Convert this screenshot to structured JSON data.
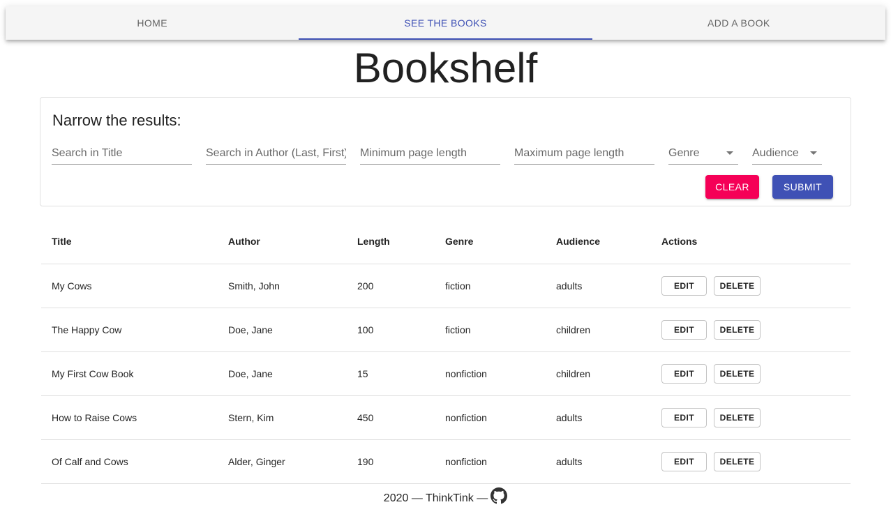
{
  "tabs": [
    {
      "label": "HOME",
      "active": false
    },
    {
      "label": "SEE THE BOOKS",
      "active": true
    },
    {
      "label": "ADD A BOOK",
      "active": false
    }
  ],
  "page_title": "Bookshelf",
  "filters": {
    "heading": "Narrow the results:",
    "title_placeholder": "Search in Title",
    "author_placeholder": "Search in Author (Last, First)",
    "min_placeholder": "Minimum page length",
    "max_placeholder": "Maximum page length",
    "genre_label": "Genre",
    "audience_label": "Audience",
    "clear_label": "CLEAR",
    "submit_label": "SUBMIT"
  },
  "table": {
    "headers": [
      "Title",
      "Author",
      "Length",
      "Genre",
      "Audience",
      "Actions"
    ],
    "rows": [
      {
        "title": "My Cows",
        "author": "Smith, John",
        "length": "200",
        "genre": "fiction",
        "audience": "adults"
      },
      {
        "title": "The Happy Cow",
        "author": "Doe, Jane",
        "length": "100",
        "genre": "fiction",
        "audience": "children"
      },
      {
        "title": "My First Cow Book",
        "author": "Doe, Jane",
        "length": "15",
        "genre": "nonfiction",
        "audience": "children"
      },
      {
        "title": "How to Raise Cows",
        "author": "Stern, Kim",
        "length": "450",
        "genre": "nonfiction",
        "audience": "adults"
      },
      {
        "title": "Of Calf and Cows",
        "author": "Alder, Ginger",
        "length": "190",
        "genre": "nonfiction",
        "audience": "adults"
      }
    ],
    "edit_label": "EDIT",
    "delete_label": "DELETE"
  },
  "footer": {
    "text": "2020 — ThinkTink —",
    "icon": "github-icon"
  },
  "colors": {
    "primary": "#3f51b5",
    "secondary": "#f50057"
  }
}
